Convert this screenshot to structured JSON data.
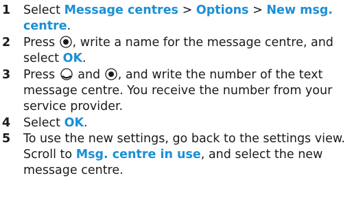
{
  "steps": [
    {
      "number": "1",
      "select": "Select",
      "item1": "Message centres",
      "sep1": ">",
      "item2": "Options",
      "sep2": ">",
      "item3": "New msg. centre",
      "end": "."
    },
    {
      "number": "2",
      "press": "Press",
      "icon": "select-key-icon",
      "middle": ", write a name for the message centre, and select",
      "item1": "OK",
      "end": "."
    },
    {
      "number": "3",
      "press": "Press",
      "icon1": "scroll-down-key-icon",
      "and": "and",
      "icon2": "select-key-icon",
      "rest": ", and write the number of the text message centre. You receive the number from your service provider."
    },
    {
      "number": "4",
      "select": "Select",
      "item1": "OK",
      "end": "."
    },
    {
      "number": "5",
      "text1": "To use the new settings, go back to the settings view. Scroll to",
      "item1": "Msg. centre in use",
      "text2": ", and select the new message centre."
    }
  ],
  "colors": {
    "highlight": "#1a8fd6",
    "text": "#1a1a1a"
  }
}
